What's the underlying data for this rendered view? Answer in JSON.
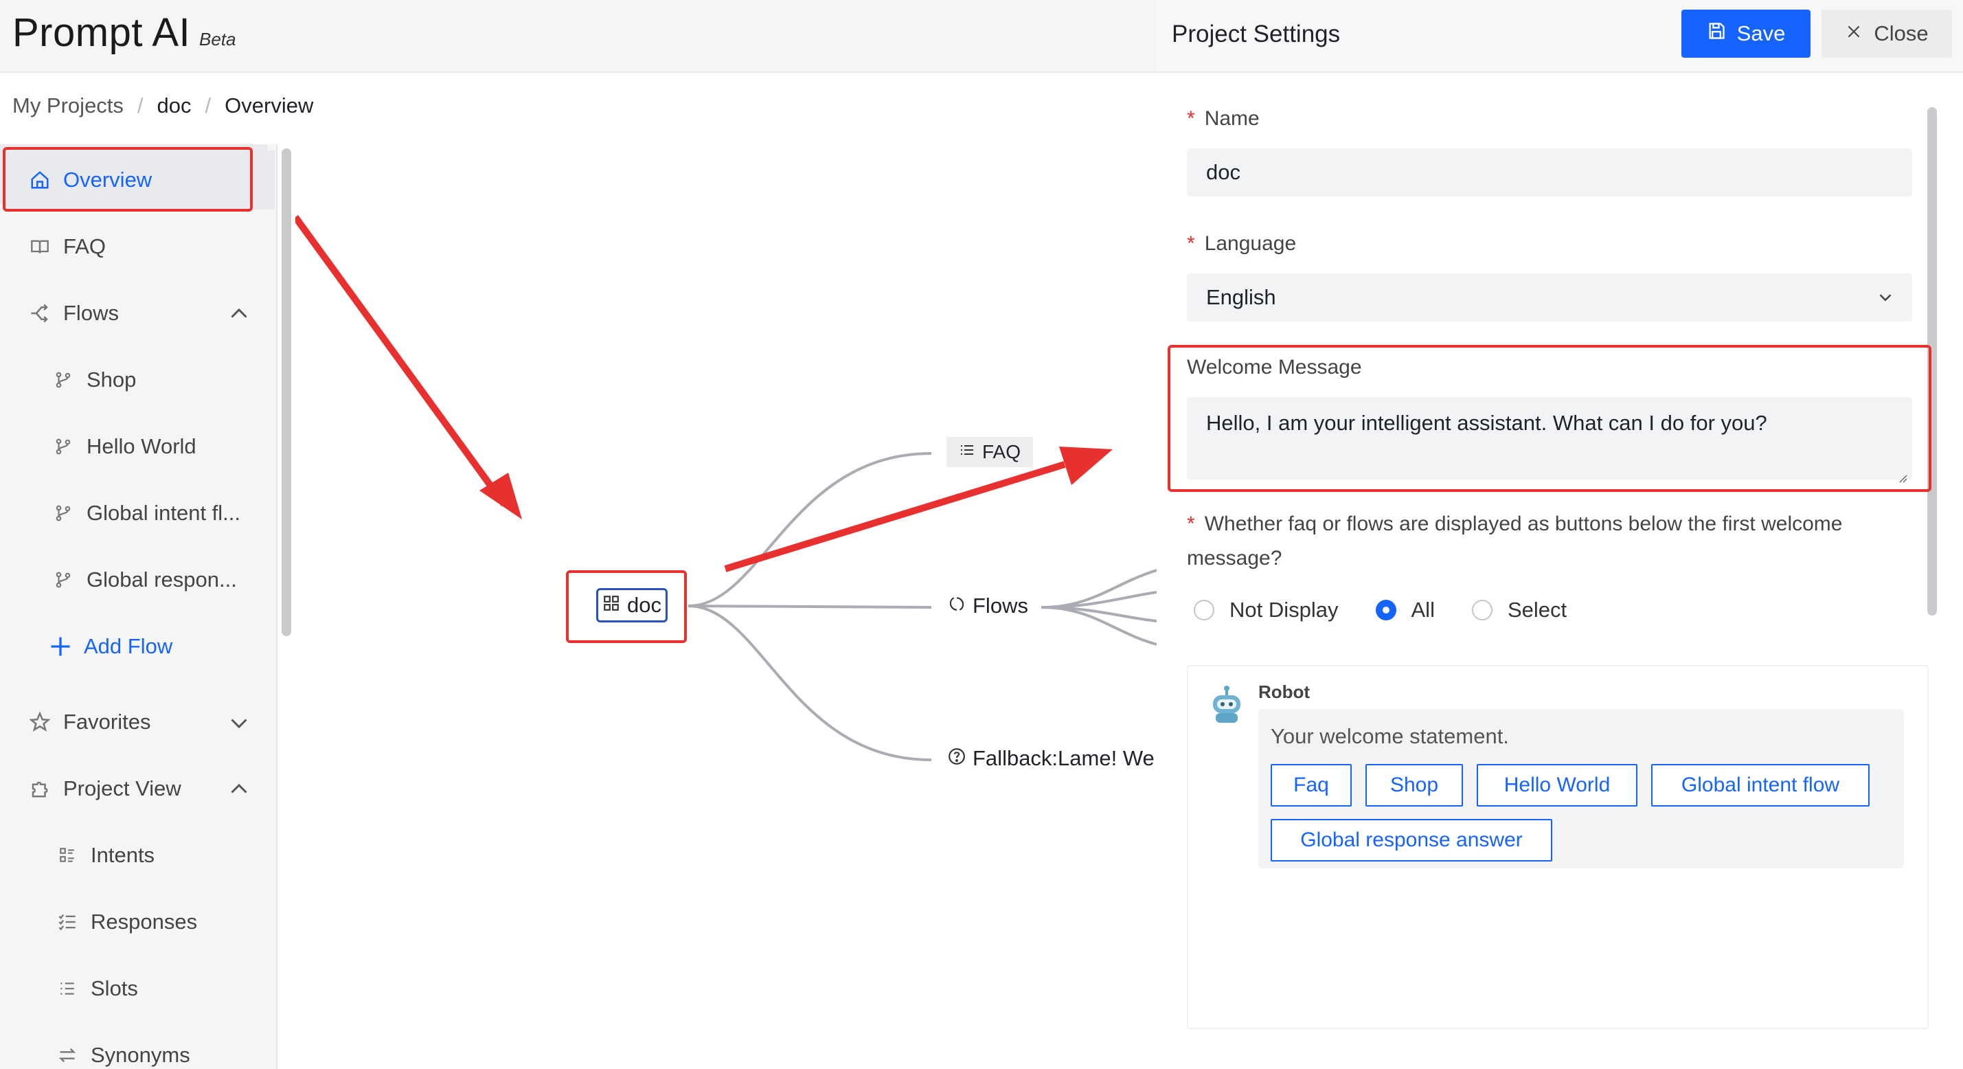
{
  "app": {
    "title": "Prompt AI",
    "badge": "Beta"
  },
  "breadcrumb": [
    "My Projects",
    "doc",
    "Overview"
  ],
  "sidebar": {
    "items": [
      {
        "label": "Overview",
        "icon": "home-icon",
        "active": true
      },
      {
        "label": "FAQ",
        "icon": "book-icon"
      },
      {
        "label": "Flows",
        "icon": "flows-icon",
        "chevron": "up"
      },
      {
        "label": "Shop",
        "icon": "branch-icon",
        "sub": true
      },
      {
        "label": "Hello World",
        "icon": "branch-icon",
        "sub": true
      },
      {
        "label": "Global intent fl...",
        "icon": "branch-icon",
        "sub": true
      },
      {
        "label": "Global respon...",
        "icon": "branch-icon",
        "sub": true
      },
      {
        "label": "Add Flow",
        "icon": "plus-icon"
      },
      {
        "label": "Favorites",
        "icon": "star-icon",
        "chevron": "down"
      },
      {
        "label": "Project View",
        "icon": "puzzle-icon",
        "chevron": "up"
      },
      {
        "label": "Intents",
        "icon": "intents-icon",
        "sub": true
      },
      {
        "label": "Responses",
        "icon": "responses-icon",
        "sub": true
      },
      {
        "label": "Slots",
        "icon": "slots-icon",
        "sub": true
      },
      {
        "label": "Synonyms",
        "icon": "synonyms-icon",
        "sub": true
      }
    ]
  },
  "canvas": {
    "root": "doc",
    "children": {
      "faq": "FAQ",
      "flows": "Flows",
      "fallback": "Fallback:Lame! We"
    }
  },
  "panel": {
    "title": "Project Settings",
    "save_label": "Save",
    "close_label": "Close",
    "name_label": "Name",
    "name_value": "doc",
    "language_label": "Language",
    "language_value": "English",
    "welcome_label": "Welcome Message",
    "welcome_value": "Hello, I am your intelligent assistant. What can I do for you?",
    "display_question": "Whether faq or flows are displayed as buttons below the first welcome message?",
    "display_options": [
      "Not Display",
      "All",
      "Select"
    ],
    "display_selected": "All",
    "preview": {
      "bot_name": "Robot",
      "statement": "Your welcome statement.",
      "buttons": [
        "Faq",
        "Shop",
        "Hello World",
        "Global intent flow",
        "Global response answer"
      ]
    }
  },
  "colors": {
    "accent": "#1664ff",
    "annotation": "#e8312f"
  }
}
